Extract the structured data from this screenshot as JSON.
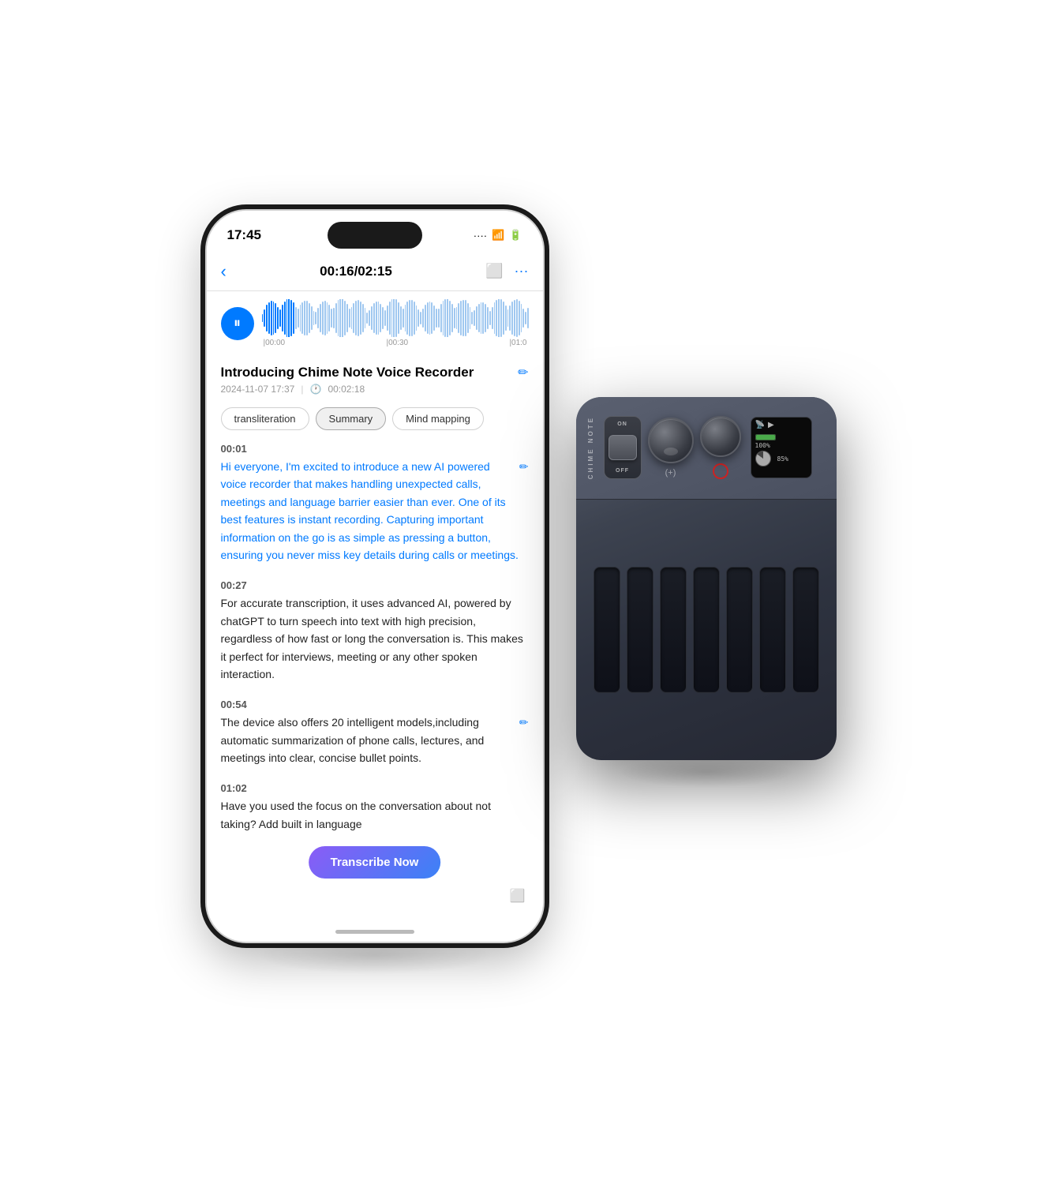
{
  "phone": {
    "status": {
      "time": "17:45",
      "signal": ".....",
      "wifi": "WiFi",
      "battery": "Bat"
    },
    "nav": {
      "back_label": "‹",
      "title": "00:16/02:15",
      "export_label": "⬜",
      "more_label": "···"
    },
    "waveform": {
      "timeline": [
        "00:00",
        "|00:30",
        "|01:0"
      ]
    },
    "recording": {
      "title": "Introducing Chime Note Voice Recorder",
      "date": "2024-11-07 17:37",
      "duration": "00:02:18"
    },
    "tabs": [
      {
        "label": "transliteration",
        "active": false
      },
      {
        "label": "Summary",
        "active": true
      },
      {
        "label": "Mind mapping",
        "active": false
      }
    ],
    "transcript": [
      {
        "time": "00:01",
        "text": "Hi everyone, I'm excited to introduce a new AI powered voice recorder that makes handling unexpected calls, meetings and language barrier easier than ever. One of its best features is instant recording. Capturing important information on the go is as simple as pressing a button, ensuring you never miss key details during calls or meetings.",
        "highlighted": true
      },
      {
        "time": "00:27",
        "text": "For accurate transcription, it uses advanced AI, powered by chatGPT to turn speech into text with high precision, regardless of how fast or long the conversation is. This makes it perfect for interviews, meeting or any other spoken interaction.",
        "highlighted": false
      },
      {
        "time": "00:54",
        "text": "The device also offers 20 intelligent models,including automatic summarization of phone calls, lectures, and meetings into clear, concise bullet points.",
        "highlighted": false
      },
      {
        "time": "01:02",
        "text": "Have you used the focus on the conversation about not taking? Add built in language",
        "highlighted": false,
        "truncated": true
      }
    ],
    "transcribe_btn": "Transcribe Now"
  },
  "device": {
    "brand": "CHIME NOTE",
    "toggle": {
      "on_label": "ON",
      "off_label": "OFF"
    },
    "knob_left_icon": "(+)",
    "knob_right_icon": "○",
    "lcd": {
      "wifi_icon": "(·))",
      "play_icon": "▶",
      "battery_pct": "100%",
      "storage_pct": "85%",
      "battery_fill": 100,
      "storage_fill": 85
    }
  }
}
